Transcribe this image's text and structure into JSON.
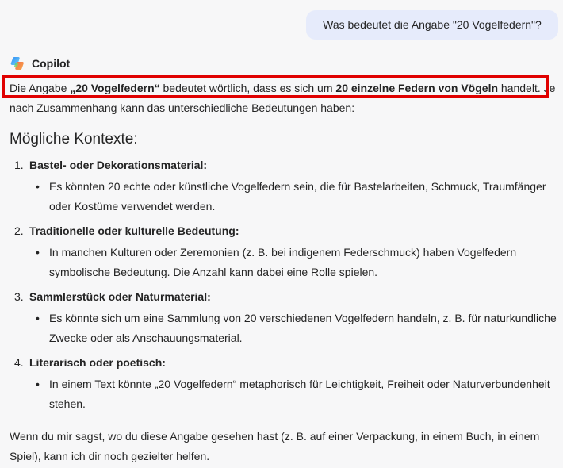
{
  "user_message": "Was bedeutet die Angabe \"20 Vogelfedern\"?",
  "assistant": {
    "name": "Copilot",
    "logo_icon": "copilot-logo-icon"
  },
  "response": {
    "intro_parts": {
      "p1": "Die Angabe ",
      "b1": "„20 Vogelfedern“",
      "p2": " bedeutet wörtlich, dass es sich um ",
      "b2": "20 einzelne Federn von Vögeln",
      "p3": " handelt. Je nach Zusammenhang kann das unterschiedliche Bedeutungen haben:"
    },
    "heading": "Mögliche Kontexte:",
    "contexts": [
      {
        "num": "1.",
        "title": "Bastel- oder Dekorationsmaterial:",
        "text": "Es könnten 20 echte oder künstliche Vogelfedern sein, die für Bastelarbeiten, Schmuck, Traumfänger oder Kostüme verwendet werden."
      },
      {
        "num": "2.",
        "title": "Traditionelle oder kulturelle Bedeutung:",
        "text": "In manchen Kulturen oder Zeremonien (z. B. bei indigenem Federschmuck) haben Vogelfedern symbolische Bedeutung. Die Anzahl kann dabei eine Rolle spielen."
      },
      {
        "num": "3.",
        "title": "Sammlerstück oder Naturmaterial:",
        "text": "Es könnte sich um eine Sammlung von 20 verschiedenen Vogelfedern handeln, z. B. für naturkundliche Zwecke oder als Anschauungsmaterial."
      },
      {
        "num": "4.",
        "title": "Literarisch oder poetisch:",
        "text": "In einem Text könnte „20 Vogelfedern“ metaphorisch für Leichtigkeit, Freiheit oder Naturverbundenheit stehen."
      }
    ],
    "bullet": "•",
    "outro": "Wenn du mir sagst, wo du diese Angabe gesehen hast (z. B. auf einer Verpackung, in einem Buch, in einem Spiel), kann ich dir noch gezielter helfen."
  },
  "highlight_color": "#e00000"
}
